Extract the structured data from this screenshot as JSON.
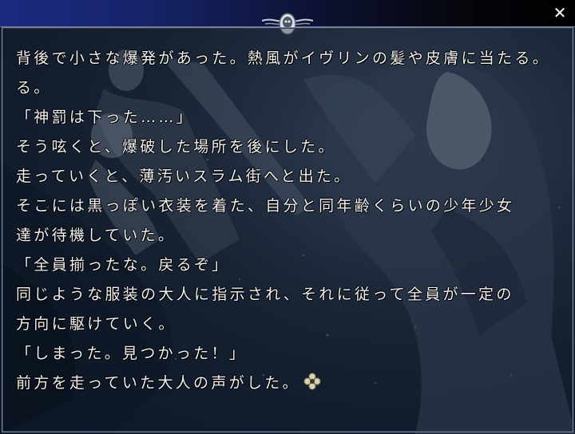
{
  "window": {
    "close_glyph": "✕"
  },
  "dialogue": {
    "lines": [
      "背後で小さな爆発があった。熱風がイヴリンの髪や皮膚に当たる。",
      "る。",
      "「神罰は下った……」",
      "そう呟くと、爆破した場所を後にした。",
      "走っていくと、薄汚いスラム街へと出た。",
      "そこには黒っぽい衣装を着た、自分と同年齢くらいの少年少女",
      "達が待機していた。",
      "「全員揃ったな。戻るぞ」",
      "同じような服装の大人に指示され、それに従って全員が一定の",
      "方向に駆けていく。",
      "「しまった。見つかった！」",
      "前方を走っていた大人の声がした。"
    ]
  },
  "icons": {
    "close": "close-icon",
    "emblem": "skull-emblem-icon",
    "advance": "clover-cursor-icon"
  },
  "colors": {
    "titlebar_left": "#1b2a80",
    "background": "#1f2a3a",
    "text": "#f2f2f2",
    "cursor": "#d8d2b4"
  }
}
